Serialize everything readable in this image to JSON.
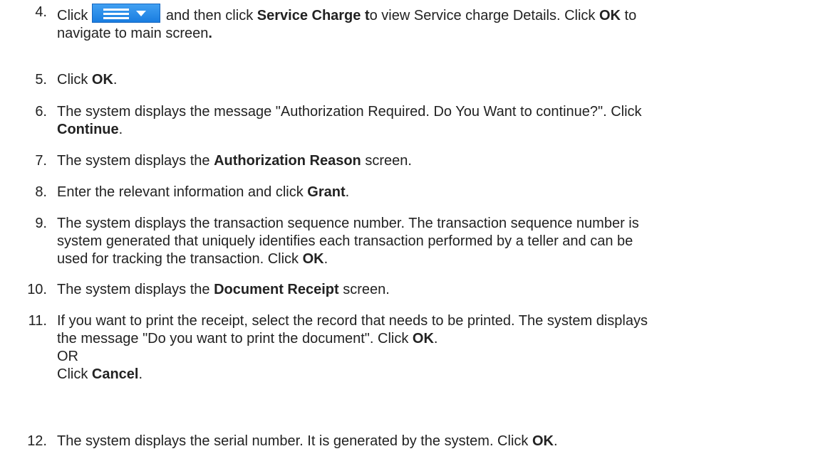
{
  "steps": [
    {
      "num": "4.",
      "t1": "Click",
      "t2": " and then click ",
      "b1": "Service Charge t",
      "t3": "o view Service charge Details. Click ",
      "b2": "OK",
      "t4": " to",
      "l2": "navigate to main screen",
      "l2b": "."
    },
    {
      "num": "5.",
      "t1": "Click ",
      "b1": "OK",
      "t2": "."
    },
    {
      "num": "6.",
      "l1": "The system displays the message \"Authorization Required. Do You Want to continue?\". Click",
      "b1": "Continue",
      "t2": "."
    },
    {
      "num": "7.",
      "t1": "The system displays the ",
      "b1": "Authorization Reason",
      "t2": " screen."
    },
    {
      "num": "8.",
      "t1": "Enter the relevant information and click ",
      "b1": "Grant",
      "t2": "."
    },
    {
      "num": "9.",
      "l1": "The system displays the transaction sequence number. The transaction sequence number is",
      "l2": "system generated that uniquely identifies each transaction performed by a teller and can be",
      "l3": "used for tracking the transaction. Click ",
      "b1": "OK",
      "t4": "."
    },
    {
      "num": "10.",
      "t1": "The system displays the ",
      "b1": "Document Receipt",
      "t2": " screen."
    },
    {
      "num": "11.",
      "l1": "If you want to print the receipt, select the record that needs to be printed. The system displays",
      "l2": "the message \"Do you want to print the document\". Click ",
      "b1": "OK",
      "t2": ".",
      "l3": "OR",
      "l4": "Click ",
      "b2": "Cancel",
      "t4": "."
    },
    {
      "num": "12.",
      "t1": "The system displays the serial number. It is generated by the system. Click ",
      "b1": "OK",
      "t2": "."
    }
  ],
  "icons": {
    "menu_button": "hamburger-menu-dropdown-icon",
    "menu_button_color": "#2a8be8"
  }
}
